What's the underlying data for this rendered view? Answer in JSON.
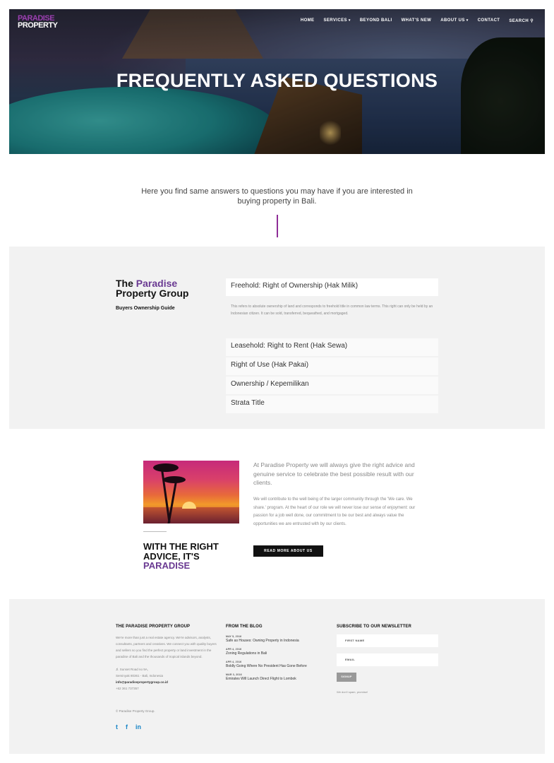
{
  "brand": {
    "logo_line1": "PARADISE",
    "logo_line2": "PROPERTY",
    "accent": "#6a3a92"
  },
  "nav": {
    "items": [
      {
        "label": "HOME"
      },
      {
        "label": "SERVICES",
        "has_dropdown": true
      },
      {
        "label": "BEYOND BALI"
      },
      {
        "label": "WHAT'S NEW"
      },
      {
        "label": "ABOUT US",
        "has_dropdown": true
      },
      {
        "label": "CONTACT"
      },
      {
        "label": "SEARCH",
        "icon": "search-icon"
      }
    ]
  },
  "hero": {
    "title": "FREQUENTLY ASKED QUESTIONS"
  },
  "intro": {
    "text": "Here you find same answers to questions you may have if you are interested in buying property in Bali."
  },
  "faq": {
    "heading_prefix": "The ",
    "heading_highlight": "Paradise",
    "heading_rest": "Property Group",
    "subheading": "Buyers Ownership Guide",
    "items": [
      {
        "question": "Freehold: Right of Ownership (Hak Milik)",
        "answer": "This refers to absolute ownership of land and corresponds to freehold title in common law terms. This right can only be held by an Indonesian citizen. It can be sold, transferred, bequeathed, and mortgaged.",
        "open": true
      },
      {
        "question": "Leasehold: Right to Rent (Hak Sewa)"
      },
      {
        "question": "Right of Use (Hak Pakai)"
      },
      {
        "question": "Ownership / Kepemilikan"
      },
      {
        "question": "Strata Title"
      }
    ]
  },
  "about": {
    "title_line1": "WITH THE RIGHT",
    "title_line2": "ADVICE, IT'S",
    "title_highlight": "PARADISE",
    "lead": "At Paradise Property we will always give the right advice and genuine service to celebrate the best possible result with our clients.",
    "body": "We will contribute to the well being of the larger community through the 'We care. We share.' program. At the heart of our role we will never lose our sense of enjoyment: our passion for a job well done, our commitment to be our best and always value the opportunities we are entrusted with by our clients.",
    "button": "READ MORE ABOUT US"
  },
  "footer": {
    "col1": {
      "heading": "THE PARADISE PROPERTY GROUP",
      "text": "We're more than just a real estate agency. We're advisors, analysts, consultants, partners and creatives. We connect you with quality buyers and sellers so you find the perfect property or land investment in the paradise of Bali and the thousands of tropical islands beyond.",
      "address1": "Jl. Sunset Road no 9A,",
      "address2": "Seminyak 80361 - Bali, Indonesia",
      "email": "info@paradisepropertygroup.co.id",
      "phone": "+62 361 737357",
      "copyright": "© Paradise Property Group."
    },
    "col2": {
      "heading": "FROM THE BLOG",
      "posts": [
        {
          "date": "MAY 5, 2016",
          "title": "Safe as Houses: Owning Property in Indonesia"
        },
        {
          "date": "APR 4, 2016",
          "title": "Zoning Regulations in Bali"
        },
        {
          "date": "APR 4, 2016",
          "title": "Boldly Going Where No President Has Gone Before"
        },
        {
          "date": "MAR 3, 2016",
          "title": "Emirates Will Launch Direct Flight to Lombok"
        }
      ]
    },
    "col3": {
      "heading": "SUBSCRIBE TO OUR NEWSLETTER",
      "first_name_placeholder": "FIRST NAME",
      "email_placeholder": "EMAIL",
      "button": "SIGNUP",
      "note": "We don't spam, promise!"
    },
    "social": [
      {
        "icon": "twitter-icon",
        "glyph": "t"
      },
      {
        "icon": "facebook-icon",
        "glyph": "f"
      },
      {
        "icon": "linkedin-icon",
        "glyph": "in"
      }
    ]
  }
}
